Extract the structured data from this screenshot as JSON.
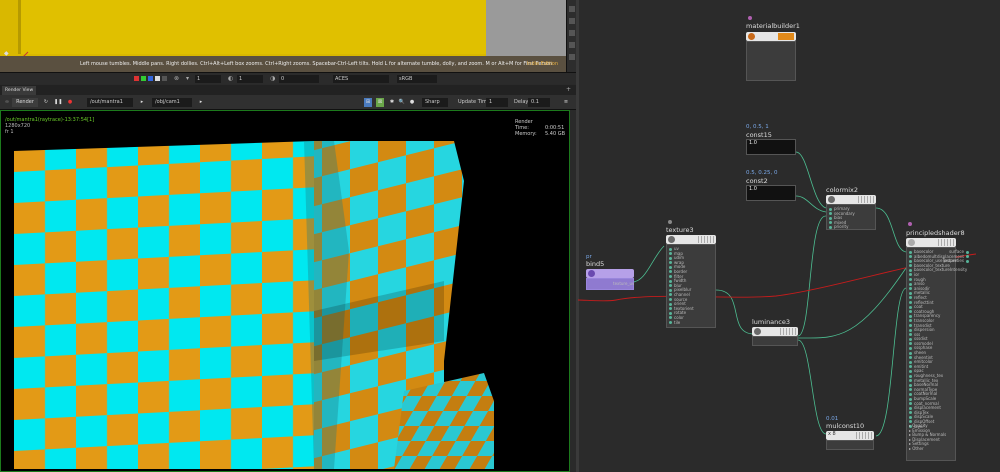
{
  "viewport": {
    "hint": "Left mouse tumbles. Middle pans. Right dollies. Ctrl+Alt+Left box zooms. Ctrl+Right zooms. Spacebar-Ctrl-Left tilts. Hold L for alternate tumble, dolly, and zoom.    M or Alt+M for First Person Navigation.",
    "edition": "Indie Edition"
  },
  "display_bar": {
    "value1": "1",
    "value2": "1",
    "value3": "0",
    "color_space": "ACES",
    "output": "sRGB"
  },
  "panel_tab": "Render View",
  "render_toolbar": {
    "render_label": "Render",
    "rop_path": "/out/mantra1",
    "camera_path": "/obj/cam1",
    "mode": "Sharp",
    "update_time_label": "Update Time",
    "update_time_value": "1",
    "delay_label": "Delay",
    "delay_value": "0.1"
  },
  "render_info": {
    "path": "/out/mantra1(raytrace)-13:37:54[1]",
    "resolution": "1280x720",
    "extra": "fr 1",
    "render_time_label": "Render Time:",
    "render_time_value": "0:00:51",
    "memory_label": "Memory:",
    "memory_value": "5.40 GB"
  },
  "nodes": {
    "materialbuilder": {
      "name": "materialbuilder1"
    },
    "const15": {
      "name": "const15",
      "value": "0, 0.5, 1",
      "display": "1.0"
    },
    "const2": {
      "name": "const2",
      "value": "0.5, 0.25, 0",
      "display": "1.0"
    },
    "colormix2": {
      "name": "colormix2",
      "ports": [
        "primary",
        "secondary",
        "bias",
        "mixed",
        "priority"
      ]
    },
    "bind5": {
      "name": "bind5",
      "tag": "pr",
      "port_out": "texture_uv"
    },
    "texture3": {
      "name": "texture3",
      "ports": [
        "uv",
        "map",
        "udim",
        "wrap",
        "mode",
        "border",
        "filter",
        "fwidth",
        "blur",
        "pixelblur",
        "channel",
        "source",
        "orient",
        "textorient",
        "rotate",
        "color",
        "tile"
      ]
    },
    "luminance3": {
      "name": "luminance3"
    },
    "mulconst10": {
      "name": "mulconst10",
      "value": "0.01",
      "display": "x 8"
    },
    "principledshader8": {
      "name": "principledshader8",
      "ports": [
        "basecolor",
        "albedomult",
        "basecolor_useTexture",
        "basecolor_texture",
        "basecolor_textureIntensity",
        "ior",
        "rough",
        "aniso",
        "anisodir",
        "metallic",
        "reflect",
        "reflecttint",
        "coat",
        "coatrough",
        "transparency",
        "transcolor",
        "transdist",
        "dispersion",
        "sss",
        "sssdist",
        "sssmodel",
        "sssphase",
        "sheen",
        "sheentint",
        "emitcolor",
        "emitint",
        "opac",
        "roughness_tex",
        "metallic_tex",
        "baseNormal",
        "normalType",
        "coatNormal",
        "bumpScale",
        "coat_normal",
        "displacement",
        "dispTex",
        "dispScale",
        "dispOffset",
        "layer"
      ],
      "groups": [
        "Opacity",
        "Emission",
        "Bump & Normals",
        "Displacement",
        "Settings",
        "Other"
      ],
      "outputs": [
        "surface",
        "displacement",
        "properties"
      ]
    }
  }
}
